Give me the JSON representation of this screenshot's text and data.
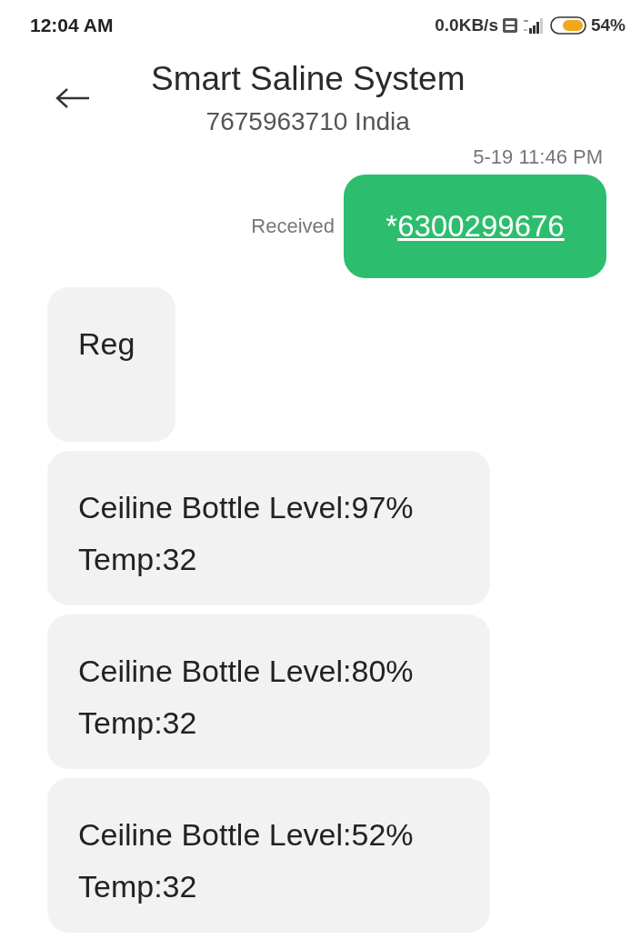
{
  "status_bar": {
    "time": "12:04 AM",
    "speed": "0.0KB/s",
    "battery": "54%"
  },
  "header": {
    "title": "Smart Saline System",
    "subtitle": "7675963710 India"
  },
  "timestamp": "5-19 11:46 PM",
  "messages": [
    {
      "kind": "sent",
      "status": "Received",
      "prefix": "*",
      "link": "6300299676"
    },
    {
      "kind": "received",
      "lines": [
        "Reg"
      ]
    },
    {
      "kind": "received",
      "lines": [
        "Ceiline Bottle Level:97%",
        "Temp:32"
      ]
    },
    {
      "kind": "received",
      "lines": [
        "Ceiline Bottle Level:80%",
        "Temp:32"
      ]
    },
    {
      "kind": "received",
      "lines": [
        "Ceiline Bottle Level:52%",
        "Temp:32"
      ]
    }
  ]
}
